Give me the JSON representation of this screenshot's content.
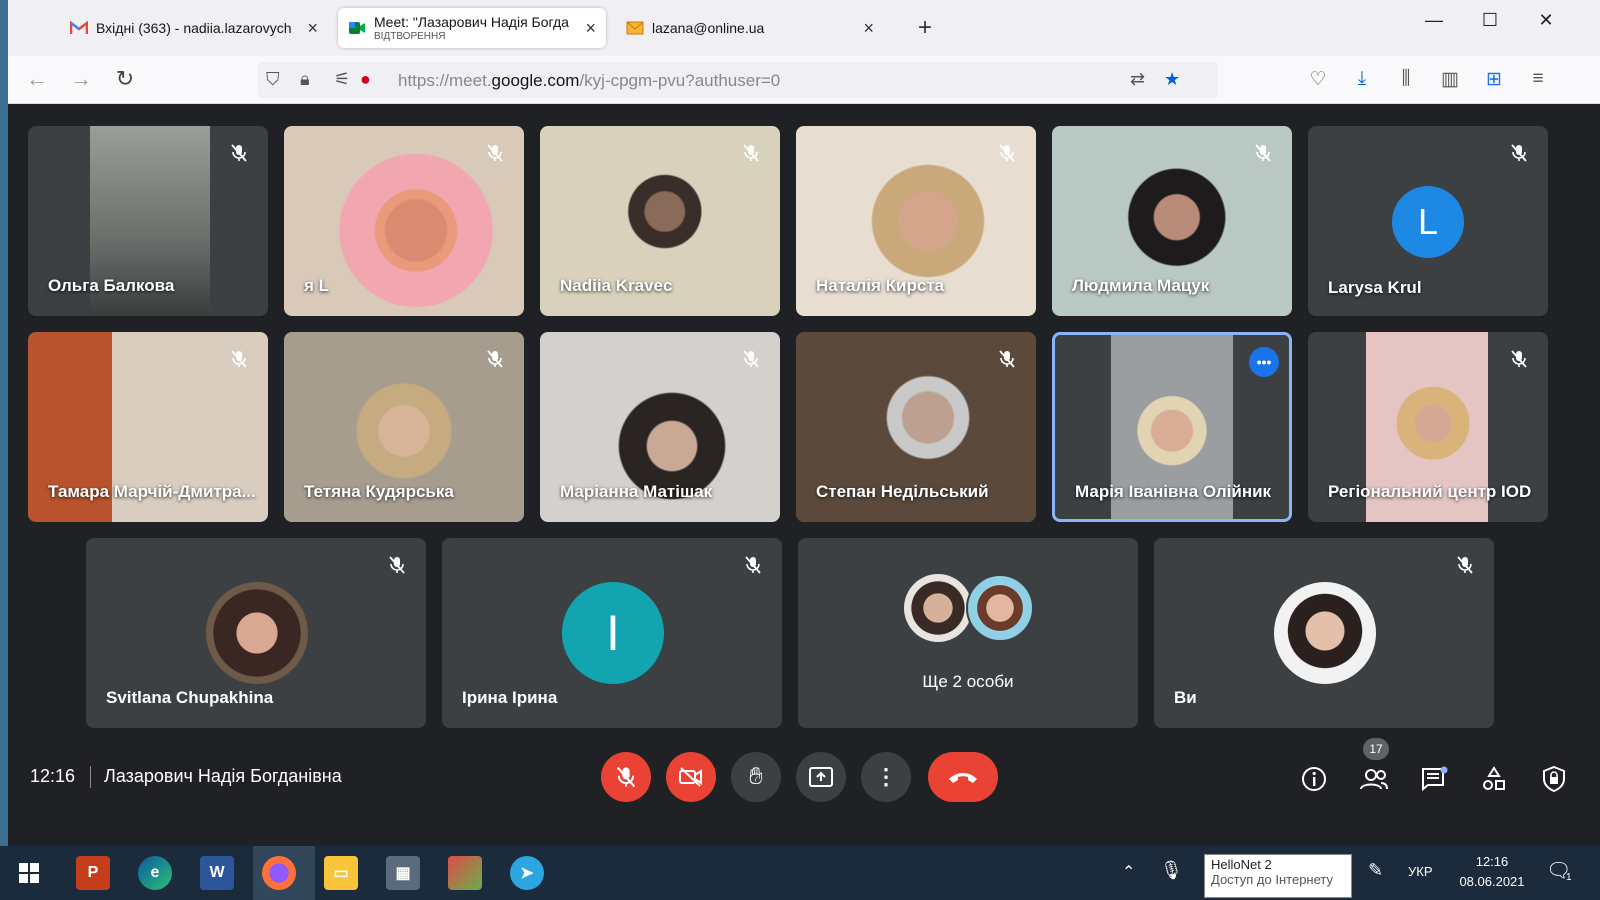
{
  "browser": {
    "tabs": [
      {
        "label": "Вхідні (363) - nadiia.lazarovych",
        "close": "×"
      },
      {
        "label": "Meet: \"Лазарович Надія Богда",
        "sub": "ВІДТВОРЕННЯ",
        "close": "×"
      },
      {
        "label": "lazana@online.ua",
        "close": "×"
      }
    ],
    "new_tab": "+",
    "url_domain": "https://meet.",
    "url_host": "google.com",
    "url_path": "/kyj-cpgm-pvu?authuser=0"
  },
  "participants": [
    {
      "name": "Ольга Балкова"
    },
    {
      "name": "я L"
    },
    {
      "name": "Nadiia Kravec"
    },
    {
      "name": "Наталія Кирста"
    },
    {
      "name": "Людмила Мацук"
    },
    {
      "name": "Larysa Krul",
      "initial": "L"
    },
    {
      "name": "Тамара Марчій-Дмитра..."
    },
    {
      "name": "Тетяна Кудярська"
    },
    {
      "name": "Маріанна Матішак"
    },
    {
      "name": "Степан Недільський"
    },
    {
      "name": "Марія Іванівна Олійник"
    },
    {
      "name": "Регіональний центр IOD"
    },
    {
      "name": "Svitlana Chupakhina"
    },
    {
      "name": "Ірина Ірина",
      "initial": "I"
    },
    {
      "name": "Ще 2 особи"
    },
    {
      "name": "Ви"
    }
  ],
  "meeting": {
    "time": "12:16",
    "title": "Лазарович Надія Богданівна",
    "participant_count": "17"
  },
  "taskbar": {
    "net_name": "HelloNet 2",
    "net_status": "Доступ до Інтернету",
    "lang": "УКР",
    "time": "12:16",
    "date": "08.06.2021",
    "notif_count": "1"
  },
  "colors": {
    "meet_bg": "#202124",
    "tile_bg": "#3c4043",
    "red": "#ea4335",
    "larysa_avatar": "#1e88e5",
    "iryna_avatar": "#12a4af",
    "active_border": "#8ab4f8"
  }
}
